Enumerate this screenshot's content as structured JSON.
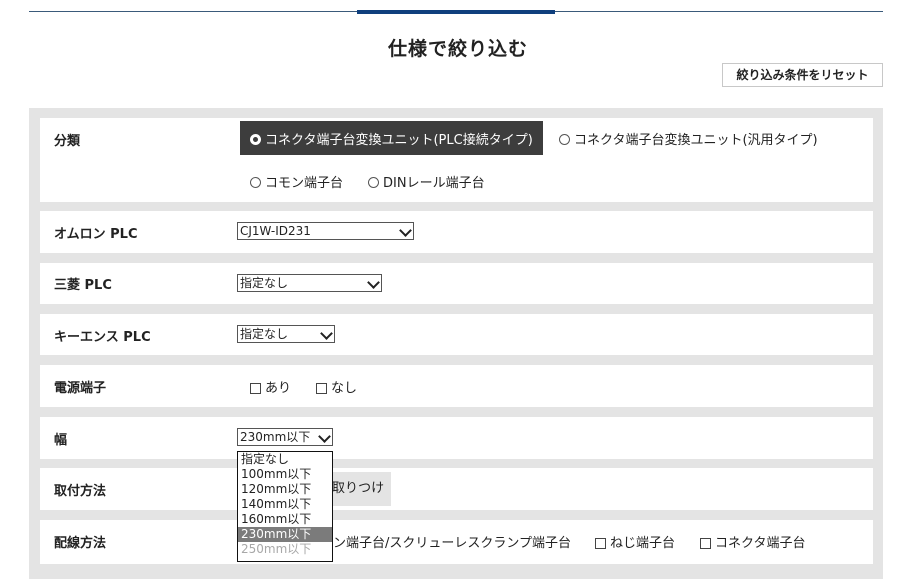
{
  "header": {
    "title": "仕様で絞り込む",
    "reset_button": "絞り込み条件をリセット"
  },
  "filters": {
    "category": {
      "label": "分類",
      "options": [
        {
          "label": "コネクタ端子台変換ユニット(PLC接続タイプ)",
          "selected": true
        },
        {
          "label": "コネクタ端子台変換ユニット(汎用タイプ)",
          "selected": false
        },
        {
          "label": "コモン端子台",
          "selected": false
        },
        {
          "label": "DINレール端子台",
          "selected": false
        }
      ]
    },
    "omron": {
      "label": "オムロン PLC",
      "value": "CJ1W-ID231"
    },
    "mitsubishi": {
      "label": "三菱 PLC",
      "value": "指定なし"
    },
    "keyence": {
      "label": "キーエンス PLC",
      "value": "指定なし"
    },
    "power_terminal": {
      "label": "電源端子",
      "options": [
        {
          "label": "あり",
          "checked": false
        },
        {
          "label": "なし",
          "checked": false
        }
      ]
    },
    "width": {
      "label": "幅",
      "value": "230mm以下",
      "options": [
        {
          "label": "指定なし",
          "state": "normal"
        },
        {
          "label": "100mm以下",
          "state": "normal"
        },
        {
          "label": "120mm以下",
          "state": "normal"
        },
        {
          "label": "140mm以下",
          "state": "normal"
        },
        {
          "label": "160mm以下",
          "state": "normal"
        },
        {
          "label": "230mm以下",
          "state": "highlight"
        },
        {
          "label": "250mm以下",
          "state": "disabled"
        }
      ]
    },
    "mounting": {
      "label": "取付方法",
      "visible_option": "取りつけ"
    },
    "wiring": {
      "label": "配線方法",
      "options": [
        {
          "label": "ン端子台/スクリューレスクランプ端子台",
          "checked": false
        },
        {
          "label": "ねじ端子台",
          "checked": false
        },
        {
          "label": "コネクタ端子台",
          "checked": false
        }
      ]
    }
  },
  "colors": {
    "accent_tab": "#0f3f7d",
    "selected_option_bg": "#3d3d3d",
    "panel_bg": "#e4e4e4",
    "highlight_option_bg": "#7b7b7b"
  }
}
